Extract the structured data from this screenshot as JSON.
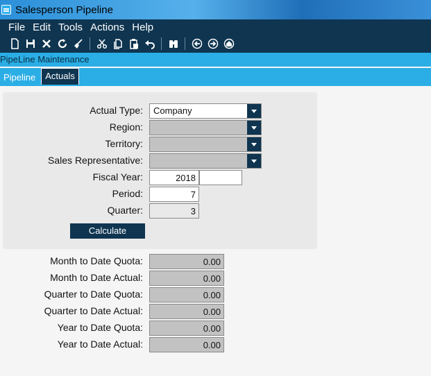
{
  "window": {
    "title": "Salesperson Pipeline"
  },
  "menu": [
    "File",
    "Edit",
    "Tools",
    "Actions",
    "Help"
  ],
  "toolbar": {
    "icons": [
      "new-icon",
      "save-icon",
      "delete-icon",
      "refresh-icon",
      "clear-icon",
      "cut-icon",
      "copy-icon",
      "paste-icon",
      "undo-icon",
      "find-icon",
      "back-icon",
      "forward-icon",
      "home-icon"
    ]
  },
  "subtitle": "PipeLine Maintenance",
  "tabs": [
    {
      "label": "Pipeline",
      "active": false
    },
    {
      "label": "Actuals",
      "active": true
    }
  ],
  "form": {
    "actual_type": {
      "label": "Actual Type:",
      "value": "Company"
    },
    "region": {
      "label": "Region:",
      "value": ""
    },
    "territory": {
      "label": "Territory:",
      "value": ""
    },
    "sales_rep": {
      "label": "Sales Representative:",
      "value": ""
    },
    "fiscal_year": {
      "label": "Fiscal Year:",
      "value": "2018",
      "extra": ""
    },
    "period": {
      "label": "Period:",
      "value": "7"
    },
    "quarter": {
      "label": "Quarter:",
      "value": "3"
    },
    "calculate_label": "Calculate"
  },
  "results": [
    {
      "label": "Month to Date Quota:",
      "value": "0.00"
    },
    {
      "label": "Month to Date Actual:",
      "value": "0.00"
    },
    {
      "label": "Quarter to Date Quota:",
      "value": "0.00"
    },
    {
      "label": "Quarter to Date Actual:",
      "value": "0.00"
    },
    {
      "label": "Year to Date Quota:",
      "value": "0.00"
    },
    {
      "label": "Year to Date Actual:",
      "value": "0.00"
    }
  ]
}
